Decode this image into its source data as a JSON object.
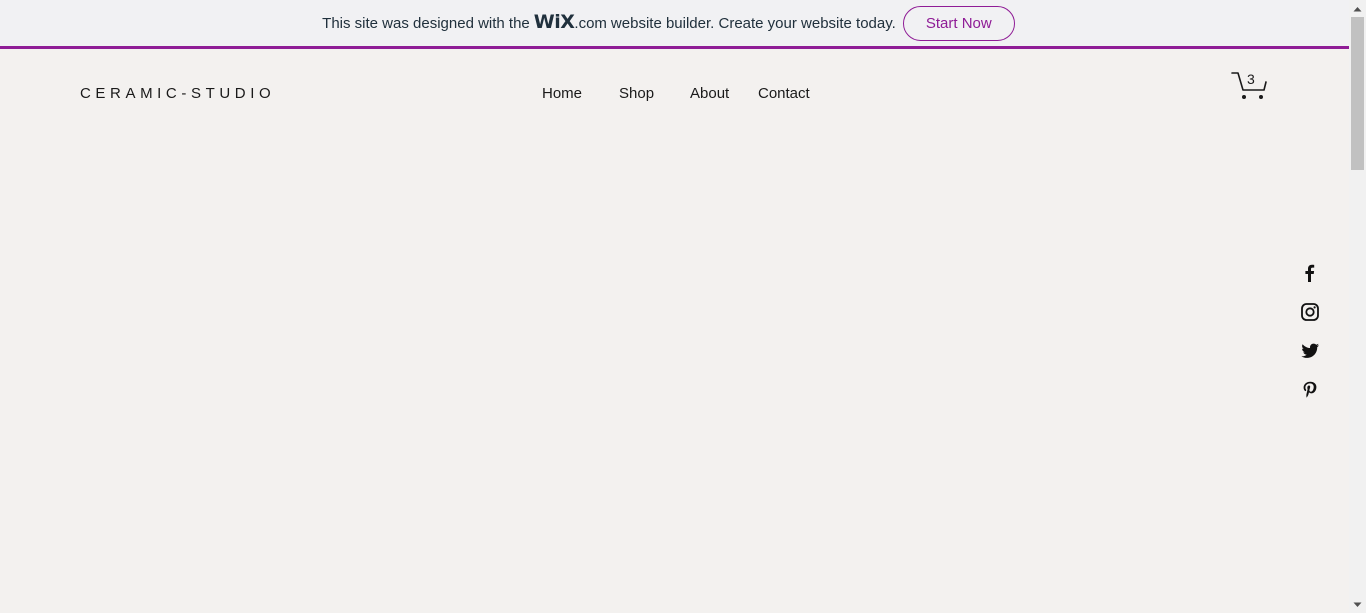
{
  "banner": {
    "text_before": "This site was designed with the",
    "wix_logo": "WiX",
    "dotcom": ".com",
    "text_after": "website builder. Create your website today.",
    "button_label": "Start Now",
    "accent_color": "#8f1c96"
  },
  "header": {
    "logo": "CERAMIC-STUDIO",
    "nav": [
      {
        "label": "Home"
      },
      {
        "label": "Shop"
      },
      {
        "label": "About"
      },
      {
        "label": "Contact"
      }
    ],
    "cart": {
      "icon": "cart-icon",
      "count": "3"
    }
  },
  "social": [
    {
      "icon": "facebook-icon"
    },
    {
      "icon": "instagram-icon"
    },
    {
      "icon": "twitter-icon"
    },
    {
      "icon": "pinterest-icon"
    }
  ],
  "scrollbar": {
    "up_icon": "scroll-up-arrow-icon",
    "down_icon": "scroll-down-arrow-icon"
  }
}
